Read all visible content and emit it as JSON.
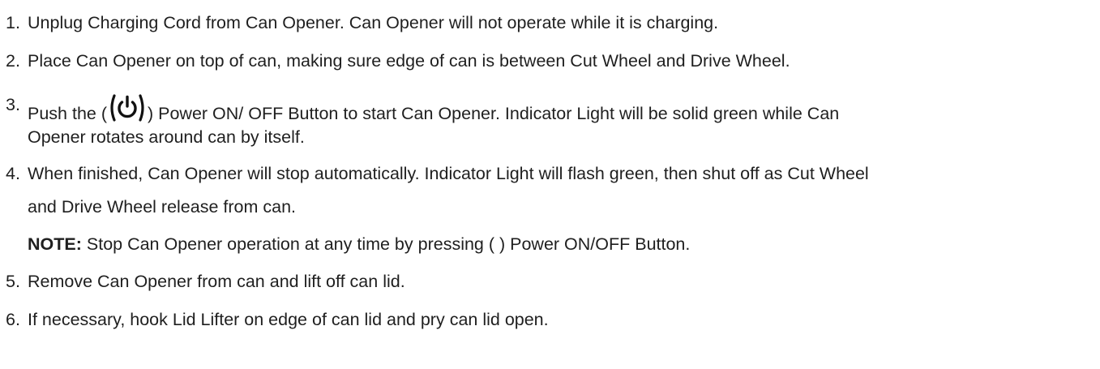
{
  "steps": [
    {
      "number": "1.",
      "text": "Unplug Charging Cord from Can Opener. Can Opener will not operate while it is charging."
    },
    {
      "number": "2.",
      "text": "Place Can Opener on top of can, making sure edge of can is between Cut Wheel and Drive Wheel."
    },
    {
      "number": "3.",
      "prefix": "Push the (",
      "icon": "power-icon",
      "suffix": ") Power ON/ OFF Button to start Can Opener. Indicator Light will be solid green while Can",
      "continuation": "Opener rotates around can by itself."
    },
    {
      "number": "4.",
      "text": "When finished, Can Opener will stop automatically. Indicator Light will flash green, then shut off as Cut Wheel",
      "continuation": "and Drive Wheel release from can."
    },
    {
      "number": "5.",
      "text": "Remove Can Opener from can and lift off can lid."
    },
    {
      "number": "6.",
      "text": "If necessary, hook Lid Lifter on edge of can lid and pry can lid open."
    }
  ],
  "note": {
    "label": "NOTE:",
    "text": "Stop Can Opener operation at any time by pressing ( ) Power ON/OFF Button."
  }
}
